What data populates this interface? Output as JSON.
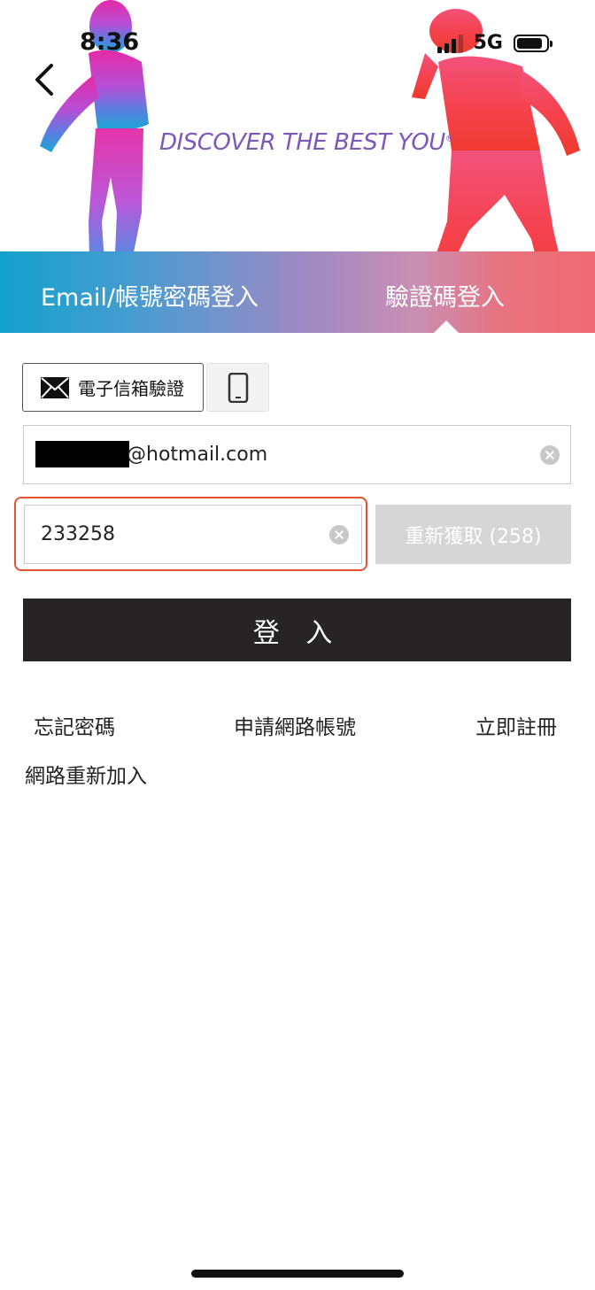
{
  "status_bar": {
    "time": "8:36",
    "network": "5G"
  },
  "hero": {
    "slogan": "DISCOVER THE BEST YOU",
    "slogan_mark": "®"
  },
  "tabs": [
    {
      "label": "Email/帳號密碼登入",
      "active": false
    },
    {
      "label": "驗證碼登入",
      "active": true
    }
  ],
  "method": {
    "email_label": "電子信箱驗證"
  },
  "email_field": {
    "value_suffix": "@hotmail.com"
  },
  "code_field": {
    "value": "233258"
  },
  "resend_button": {
    "label": "重新獲取 (258)"
  },
  "login_button": {
    "label": "登 入"
  },
  "links": {
    "forgot_password": "忘記密碼",
    "apply_account": "申請網路帳號",
    "register": "立即註冊",
    "rejoin": "網路重新加入"
  },
  "colors": {
    "accent_highlight": "#e4532e",
    "login_button": "#262424",
    "resend_disabled": "#d6d6d6",
    "slogan": "#7c59b7"
  }
}
